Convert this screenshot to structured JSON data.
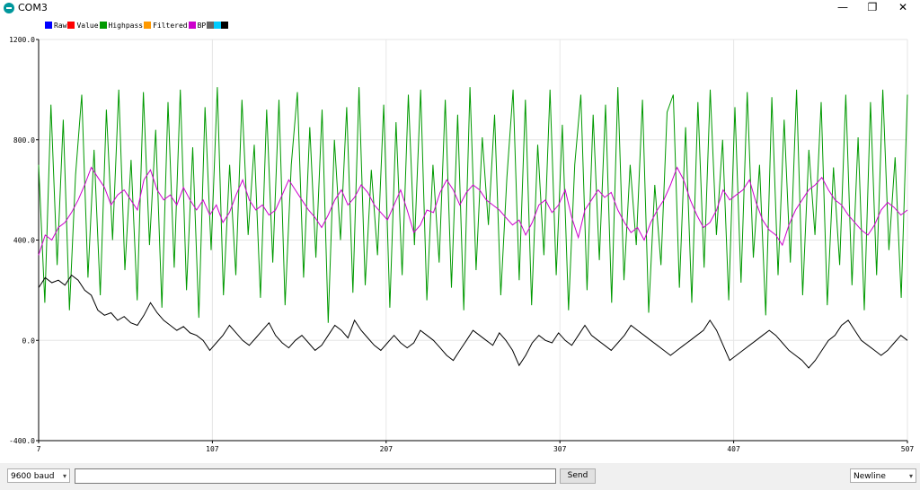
{
  "window": {
    "title": "COM3",
    "controls": {
      "minimize": "—",
      "maximize": "❐",
      "close": "✕"
    }
  },
  "legend": [
    {
      "label": "Raw",
      "color": "#0000ff"
    },
    {
      "label": "Value",
      "color": "#ff0000"
    },
    {
      "label": "Highpass",
      "color": "#009900"
    },
    {
      "label": "Filtered",
      "color": "#ff9900"
    },
    {
      "label": "BP",
      "color": "#cc00cc"
    },
    {
      "label": "",
      "color": "#666666"
    },
    {
      "label": "",
      "color": "#00ccff"
    },
    {
      "label": "",
      "color": "#000000"
    }
  ],
  "chart_data": {
    "type": "line",
    "xlim": [
      7,
      507
    ],
    "ylim": [
      -400,
      1200
    ],
    "x_ticks": [
      "7",
      "107",
      "207",
      "307",
      "407",
      "507"
    ],
    "y_ticks": [
      "1200.0",
      "800.0",
      "400.0",
      "0.0",
      "-400.0"
    ],
    "grid": true,
    "legend_position": "top-left",
    "series": [
      {
        "color": "#009900",
        "values": [
          700,
          150,
          940,
          300,
          880,
          120,
          660,
          980,
          250,
          760,
          180,
          920,
          400,
          1000,
          280,
          720,
          160,
          990,
          380,
          840,
          130,
          950,
          290,
          1000,
          200,
          770,
          90,
          930,
          360,
          1010,
          180,
          700,
          260,
          960,
          420,
          780,
          170,
          920,
          310,
          960,
          140,
          700,
          990,
          250,
          850,
          330,
          920,
          70,
          800,
          400,
          930,
          190,
          1010,
          220,
          680,
          340,
          940,
          130,
          870,
          260,
          980,
          380,
          1000,
          160,
          700,
          310,
          960,
          210,
          900,
          120,
          1010,
          280,
          810,
          460,
          900,
          180,
          650,
          1000,
          240,
          960,
          140,
          780,
          340,
          1000,
          260,
          860,
          120,
          700,
          980,
          200,
          900,
          320,
          940,
          150,
          1010,
          240,
          700,
          380,
          960,
          110,
          620,
          300,
          910,
          980,
          210,
          850,
          150,
          950,
          290,
          1000,
          420,
          800,
          160,
          930,
          230,
          990,
          330,
          700,
          100,
          970,
          260,
          880,
          310,
          1000,
          180,
          760,
          420,
          950,
          140,
          690,
          300,
          980,
          220,
          810,
          120,
          950,
          260,
          1000,
          360,
          730,
          170,
          980
        ]
      },
      {
        "color": "#cc00cc",
        "values": [
          340,
          420,
          400,
          450,
          470,
          510,
          560,
          620,
          690,
          650,
          610,
          540,
          580,
          600,
          560,
          520,
          640,
          680,
          600,
          560,
          580,
          540,
          610,
          560,
          520,
          560,
          500,
          540,
          470,
          510,
          580,
          640,
          560,
          520,
          540,
          500,
          520,
          580,
          640,
          600,
          560,
          520,
          490,
          450,
          500,
          560,
          600,
          540,
          570,
          620,
          590,
          540,
          510,
          480,
          540,
          600,
          520,
          430,
          460,
          520,
          510,
          590,
          640,
          600,
          540,
          590,
          620,
          600,
          560,
          540,
          520,
          490,
          460,
          480,
          420,
          470,
          540,
          560,
          510,
          540,
          600,
          490,
          410,
          520,
          560,
          600,
          570,
          590,
          520,
          470,
          430,
          450,
          400,
          470,
          520,
          560,
          620,
          690,
          640,
          560,
          500,
          450,
          470,
          520,
          600,
          560,
          580,
          600,
          640,
          550,
          480,
          440,
          420,
          380,
          460,
          520,
          560,
          600,
          620,
          650,
          600,
          560,
          540,
          500,
          470,
          440,
          420,
          460,
          520,
          550,
          530,
          500,
          520
        ]
      },
      {
        "color": "#000000",
        "values": [
          210,
          250,
          230,
          240,
          220,
          260,
          240,
          200,
          180,
          120,
          100,
          110,
          80,
          95,
          70,
          60,
          100,
          150,
          110,
          80,
          60,
          40,
          55,
          30,
          20,
          0,
          -40,
          -10,
          20,
          60,
          30,
          0,
          -20,
          10,
          40,
          70,
          20,
          -10,
          -30,
          0,
          20,
          -10,
          -40,
          -20,
          20,
          60,
          40,
          10,
          80,
          40,
          10,
          -20,
          -40,
          -10,
          20,
          -10,
          -30,
          -10,
          40,
          20,
          0,
          -30,
          -60,
          -80,
          -40,
          0,
          40,
          20,
          0,
          -20,
          30,
          0,
          -40,
          -100,
          -60,
          -10,
          20,
          0,
          -10,
          30,
          0,
          -20,
          20,
          60,
          20,
          0,
          -20,
          -40,
          -10,
          20,
          60,
          40,
          20,
          0,
          -20,
          -40,
          -60,
          -40,
          -20,
          0,
          20,
          40,
          80,
          40,
          -20,
          -80,
          -60,
          -40,
          -20,
          0,
          20,
          40,
          20,
          -10,
          -40,
          -60,
          -80,
          -110,
          -80,
          -40,
          0,
          20,
          60,
          80,
          40,
          0,
          -20,
          -40,
          -60,
          -40,
          -10,
          20,
          0
        ]
      }
    ]
  },
  "bottom_bar": {
    "baud": "9600 baud",
    "input_value": "",
    "send_label": "Send",
    "line_ending": "Newline"
  }
}
